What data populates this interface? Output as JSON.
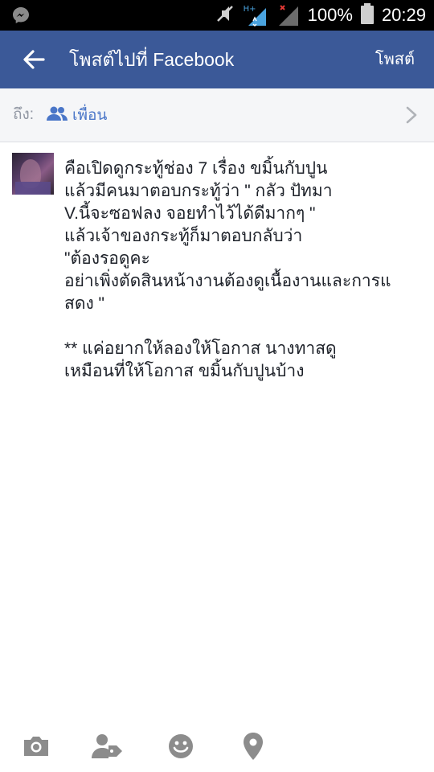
{
  "status_bar": {
    "icons": [
      "messenger-icon",
      "mute-icon",
      "signal-hplus-icon",
      "no-signal-icon",
      "battery-icon"
    ],
    "network_label": "H+",
    "battery": "100%",
    "time": "20:29"
  },
  "app_bar": {
    "back_icon": "arrow-left-icon",
    "title": "โพสต์ไปที่ Facebook",
    "post_label": "โพสต์"
  },
  "audience_row": {
    "to_label": "ถึง:",
    "audience_icon": "friends-icon",
    "audience_label": "เพื่อน",
    "chevron_icon": "chevron-right-icon"
  },
  "composer": {
    "text": "คือเปิดดูกระทู้ช่อง 7 เรื่อง ขมิ้นกับปูน\nแล้วมีคนมาตอบกระทู้ว่า \" กลัว ปัทมา\nV.นี้จะซอฟลง จอยทำไว้ได้ดีมากๆ \"\nแล้วเจ้าของกระทู้ก็มาตอบกลับว่า\n\"ต้องรอดูคะ\nอย่าเพิ่งตัดสินหน้างานต้องดูเนื้องานและการแ\nสดง \"\n\n** แค่อยากให้ลองให้โอกาส นางทาสดู\nเหมือนที่ให้โอกาส ขมิ้นกับปูนบ้าง"
  },
  "toolbar": {
    "icons": [
      "camera-icon",
      "tag-people-icon",
      "feeling-icon",
      "location-icon"
    ]
  },
  "colors": {
    "app_bar": "#3b5998",
    "audience_link": "#4a76c8",
    "icon_gray": "#8c8c8c"
  }
}
